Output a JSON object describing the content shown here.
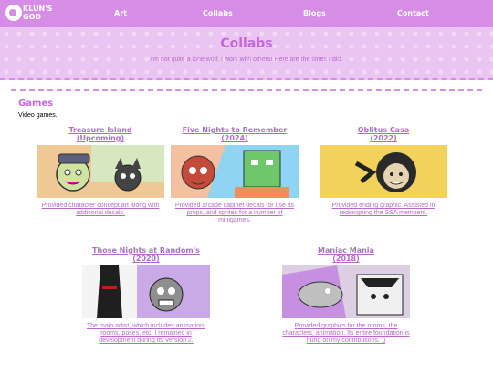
{
  "brand": {
    "line1": "KLUN'S",
    "line2": "GOD"
  },
  "nav": [
    "Art",
    "Collabs",
    "Blogs",
    "Contact"
  ],
  "hero": {
    "title": "Collabs",
    "subtitle": "I'm not quite a lone wolf. I work with others! Here are the times I did."
  },
  "section": {
    "title": "Games",
    "desc": "Video games."
  },
  "cards": [
    {
      "title": "Treasure Island",
      "year": "(Upcoming)",
      "caption": "Provided character concept art along with additional decals."
    },
    {
      "title": "Five Nights to Remember",
      "year": "(2024)",
      "caption": "Provided arcade cabinet decals for use as props, and sprites for a number of minigames."
    },
    {
      "title": "Oblitus Casa",
      "year": "(2022)",
      "caption": "Provided ending graphic. Assisted in redesigning the SSA members."
    },
    {
      "title": "Those Nights at Random's",
      "year": "(2020)",
      "caption": "The main artist, which includes animation, rooms, poses, etc. I remained in development during its Version 2."
    },
    {
      "title": "Maniac Mania",
      "year": "(2018)",
      "caption": "Provided graphics for the rooms, the characters, animation. Its entire foundation is hung on my contributions. :)"
    }
  ]
}
